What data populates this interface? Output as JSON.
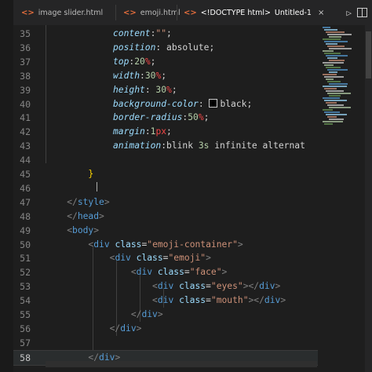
{
  "tabs": [
    {
      "icon": "<>",
      "label": "image slider.html"
    },
    {
      "icon": "<>",
      "label": "emoji.html"
    },
    {
      "icon": "<>",
      "label": "<!DOCTYPE html>",
      "extra": "Untitled-1",
      "active": true
    }
  ],
  "tab_close_glyph": "×",
  "lines": [
    {
      "n": "35",
      "indent": 1,
      "tokens": [
        [
          "prop",
          "content"
        ],
        [
          "punct",
          ":"
        ],
        [
          "val",
          "\"\""
        ],
        [
          "punct",
          ";"
        ]
      ]
    },
    {
      "n": "36",
      "indent": 1,
      "tokens": [
        [
          "prop",
          "position"
        ],
        [
          "punct",
          ": "
        ],
        [
          "plain",
          "absolute"
        ],
        [
          "punct",
          ";"
        ]
      ]
    },
    {
      "n": "37",
      "indent": 1,
      "tokens": [
        [
          "prop",
          "top"
        ],
        [
          "punct",
          ":"
        ],
        [
          "num",
          "20"
        ],
        [
          "pct",
          "%"
        ],
        [
          "punct",
          ";"
        ]
      ]
    },
    {
      "n": "38",
      "indent": 1,
      "tokens": [
        [
          "prop",
          "width"
        ],
        [
          "punct",
          ":"
        ],
        [
          "num",
          "30"
        ],
        [
          "pct",
          "%"
        ],
        [
          "punct",
          ";"
        ]
      ]
    },
    {
      "n": "39",
      "indent": 1,
      "tokens": [
        [
          "prop",
          "height"
        ],
        [
          "punct",
          ": "
        ],
        [
          "num",
          "30"
        ],
        [
          "pct",
          "%"
        ],
        [
          "punct",
          ";"
        ]
      ]
    },
    {
      "n": "40",
      "indent": 1,
      "tokens": [
        [
          "prop",
          "background-color"
        ],
        [
          "punct",
          ": "
        ],
        [
          "swatch",
          ""
        ],
        [
          "plain",
          "black"
        ],
        [
          "punct",
          ";"
        ]
      ]
    },
    {
      "n": "41",
      "indent": 1,
      "tokens": [
        [
          "prop",
          "border-radius"
        ],
        [
          "punct",
          ":"
        ],
        [
          "num",
          "50"
        ],
        [
          "pct",
          "%"
        ],
        [
          "punct",
          ";"
        ]
      ]
    },
    {
      "n": "42",
      "indent": 1,
      "tokens": [
        [
          "prop",
          "margin"
        ],
        [
          "punct",
          ":"
        ],
        [
          "num",
          "1"
        ],
        [
          "unit",
          "px"
        ],
        [
          "punct",
          ";"
        ]
      ]
    },
    {
      "n": "43",
      "indent": 1,
      "tokens": [
        [
          "prop",
          "animation"
        ],
        [
          "punct",
          ":"
        ],
        [
          "plain",
          "blink "
        ],
        [
          "num",
          "3s"
        ],
        [
          "plain",
          " infinite alternat"
        ]
      ]
    },
    {
      "n": "44",
      "indent": 0,
      "tokens": []
    },
    {
      "n": "45",
      "indent": 0,
      "tokens": [
        [
          "brace",
          "        }"
        ]
      ]
    },
    {
      "n": "46",
      "indent": 0,
      "tokens": []
    },
    {
      "n": "47",
      "indent": 0,
      "tokens": [
        [
          "plain",
          "    "
        ],
        [
          "bracket",
          "</"
        ],
        [
          "tag",
          "style"
        ],
        [
          "bracket",
          ">"
        ]
      ]
    },
    {
      "n": "48",
      "indent": 0,
      "tokens": [
        [
          "plain",
          "    "
        ],
        [
          "bracket",
          "</"
        ],
        [
          "tag",
          "head"
        ],
        [
          "bracket",
          ">"
        ]
      ]
    },
    {
      "n": "49",
      "indent": 0,
      "tokens": [
        [
          "plain",
          "    "
        ],
        [
          "bracket",
          "<"
        ],
        [
          "tag",
          "body"
        ],
        [
          "bracket",
          ">"
        ]
      ]
    },
    {
      "n": "50",
      "indent": 0,
      "tokens": [
        [
          "plain",
          "        "
        ],
        [
          "bracket",
          "<"
        ],
        [
          "tag",
          "div"
        ],
        [
          "plain",
          " "
        ],
        [
          "attr",
          "class"
        ],
        [
          "punct",
          "="
        ],
        [
          "str",
          "\"emoji-container\""
        ],
        [
          "bracket",
          ">"
        ]
      ]
    },
    {
      "n": "51",
      "indent": 0,
      "tokens": [
        [
          "plain",
          "            "
        ],
        [
          "bracket",
          "<"
        ],
        [
          "tag",
          "div"
        ],
        [
          "plain",
          " "
        ],
        [
          "attr",
          "class"
        ],
        [
          "punct",
          "="
        ],
        [
          "str",
          "\"emoji\""
        ],
        [
          "bracket",
          ">"
        ]
      ]
    },
    {
      "n": "52",
      "indent": 0,
      "tokens": [
        [
          "plain",
          "                "
        ],
        [
          "bracket",
          "<"
        ],
        [
          "tag",
          "div"
        ],
        [
          "plain",
          " "
        ],
        [
          "attr",
          "class"
        ],
        [
          "punct",
          "="
        ],
        [
          "str",
          "\"face\""
        ],
        [
          "bracket",
          ">"
        ]
      ]
    },
    {
      "n": "53",
      "indent": 0,
      "tokens": [
        [
          "plain",
          "                    "
        ],
        [
          "bracket",
          "<"
        ],
        [
          "tag",
          "div"
        ],
        [
          "plain",
          " "
        ],
        [
          "attr",
          "class"
        ],
        [
          "punct",
          "="
        ],
        [
          "str",
          "\"eyes\""
        ],
        [
          "bracket",
          "></"
        ],
        [
          "tag",
          "div"
        ],
        [
          "bracket",
          ">"
        ]
      ]
    },
    {
      "n": "54",
      "indent": 0,
      "tokens": [
        [
          "plain",
          "                    "
        ],
        [
          "bracket",
          "<"
        ],
        [
          "tag",
          "div"
        ],
        [
          "plain",
          " "
        ],
        [
          "attr",
          "class"
        ],
        [
          "punct",
          "="
        ],
        [
          "str",
          "\"mouth\""
        ],
        [
          "bracket",
          "></"
        ],
        [
          "tag",
          "div"
        ],
        [
          "bracket",
          ">"
        ]
      ]
    },
    {
      "n": "55",
      "indent": 0,
      "tokens": [
        [
          "plain",
          "                "
        ],
        [
          "bracket",
          "</"
        ],
        [
          "tag",
          "div"
        ],
        [
          "bracket",
          ">"
        ]
      ]
    },
    {
      "n": "56",
      "indent": 0,
      "tokens": [
        [
          "plain",
          "            "
        ],
        [
          "bracket",
          "</"
        ],
        [
          "tag",
          "div"
        ],
        [
          "bracket",
          ">"
        ]
      ]
    },
    {
      "n": "57",
      "indent": 0,
      "tokens": []
    },
    {
      "n": "58",
      "indent": 0,
      "active": true,
      "tokens": [
        [
          "plain",
          "        "
        ],
        [
          "bracket",
          "</"
        ],
        [
          "tag",
          "div"
        ],
        [
          "bracket",
          ">"
        ]
      ]
    }
  ],
  "colors": {
    "editor_bg": "#1e1e1e",
    "tab_bar_bg": "#252526",
    "html_icon": "#e06c3c"
  }
}
